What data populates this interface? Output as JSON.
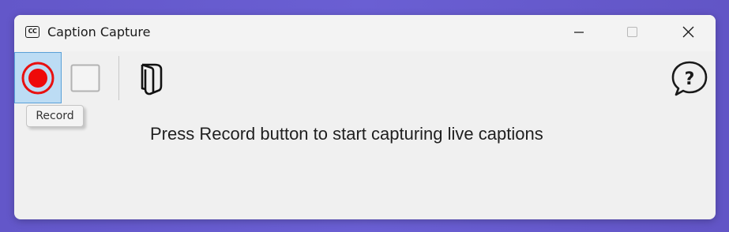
{
  "window": {
    "title": "Caption Capture",
    "app_icon_text": "CC",
    "controls": {
      "minimize": "minimize-icon",
      "maximize": "maximize-icon",
      "close": "close-icon"
    }
  },
  "toolbar": {
    "record": {
      "icon": "record-icon",
      "tooltip": "Record",
      "state": "hovered"
    },
    "stop": {
      "icon": "stop-icon",
      "enabled": false
    },
    "open_folder": {
      "icon": "open-folder-icon"
    },
    "help": {
      "icon": "help-icon"
    }
  },
  "status": {
    "message": "Press Record button to start capturing live captions"
  },
  "colors": {
    "record_red": "#e81010",
    "hover_bg": "#bcdcf4",
    "hover_border": "#5aa0d8",
    "desktop": "#6a5ccd"
  }
}
